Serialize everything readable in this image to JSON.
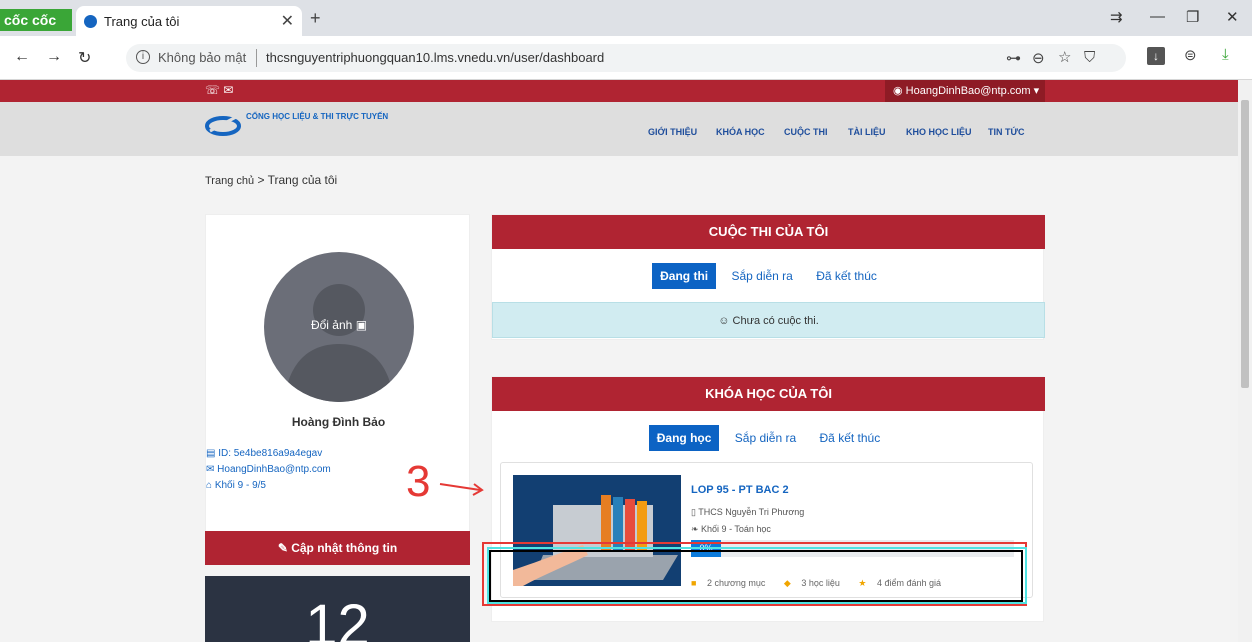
{
  "browser": {
    "brand": "cốc cốc",
    "tab_title": "Trang của tôi",
    "new_tab": "+",
    "close": "✕",
    "insecure_label": "Không bảo mật",
    "url": "thcsnguyentriphuongquan10.lms.vnedu.vn/user/dashboard"
  },
  "site": {
    "user_email_menu": "HoangDinhBao@ntp.com",
    "logo_text": "CỔNG HỌC LIỆU & THI TRỰC TUYẾN",
    "menu": [
      "GIỚI THIỆU",
      "KHÓA HỌC",
      "CUỘC THI",
      "TÀI LIỆU",
      "KHO HỌC LIỆU",
      "TIN TỨC"
    ]
  },
  "breadcrumb": {
    "home": "Trang chủ",
    "sep": ">",
    "current": "Trang của tôi"
  },
  "profile": {
    "change_avatar": "Đổi ảnh",
    "name": "Hoàng Đình Bảo",
    "id": "ID: 5e4be816a9a4egav",
    "email": "HoangDinhBao@ntp.com",
    "grade": "Khối 9 - 9/5",
    "update_button": "Cập nhật thông tin",
    "stat_number": "12"
  },
  "contests": {
    "title": "CUỘC THI CỦA TÔI",
    "tabs": [
      "Đang thi",
      "Sắp diễn ra",
      "Đã kết thúc"
    ],
    "empty": "Chưa có cuộc thi."
  },
  "courses": {
    "title": "KHÓA HỌC CỦA TÔI",
    "tabs": [
      "Đang học",
      "Sắp diễn ra",
      "Đã kết thúc"
    ],
    "items": [
      {
        "title": "LOP 95 - PT BAC 2",
        "school": "THCS Nguyễn Tri Phương",
        "grade": "Khối 9 - Toán học",
        "progress_label": "0%",
        "progress_fraction": 0,
        "chapters": "2 chương mục",
        "materials": "3 học liệu",
        "ratings": "4 điểm đánh giá"
      }
    ]
  },
  "annotation": {
    "number": "3"
  },
  "colors": {
    "brand_red": "#b02432",
    "link_blue": "#1565c0",
    "annotation_red": "#e53935",
    "annotation_cyan": "#4fe3e3"
  }
}
